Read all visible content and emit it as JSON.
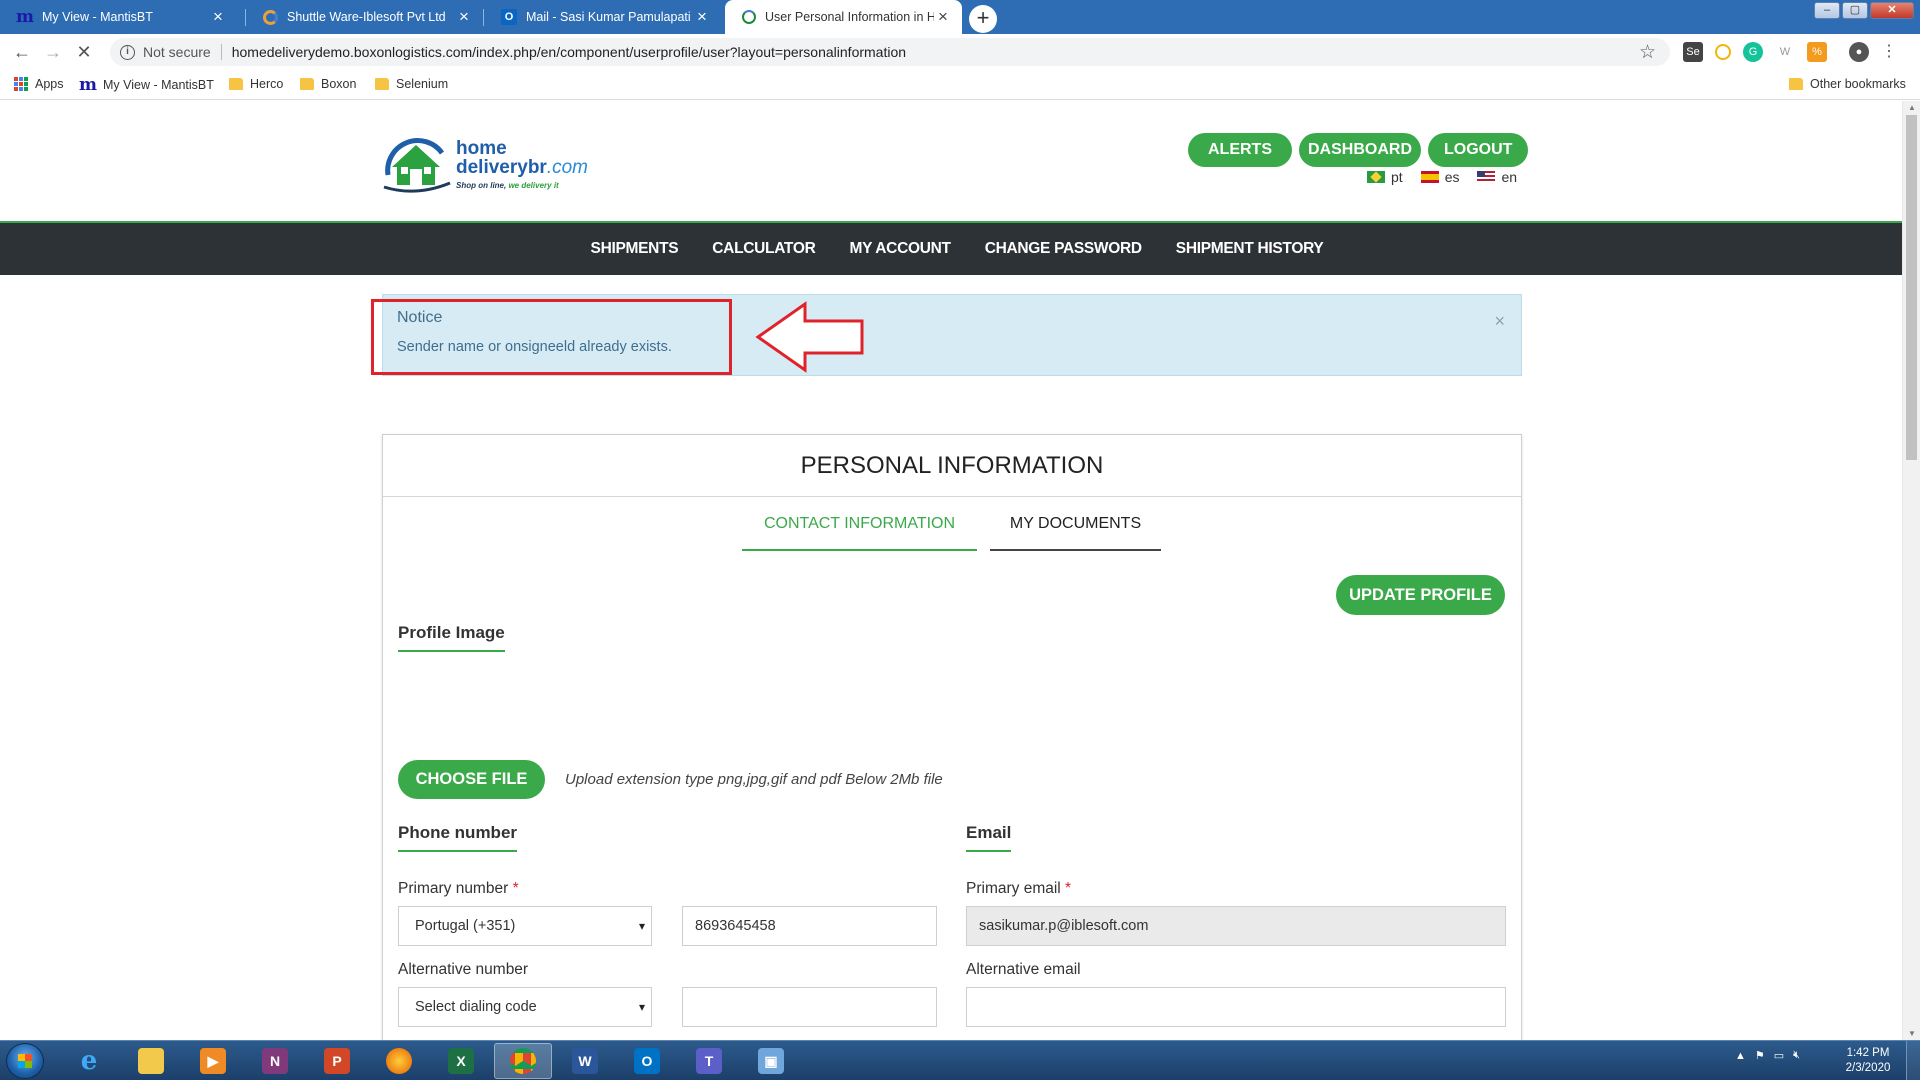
{
  "browser": {
    "tabs": [
      {
        "title": "My View - MantisBT",
        "favicon": "mantis-icon"
      },
      {
        "title": "Shuttle Ware-Iblesoft Pvt Ltd",
        "favicon": "shuttle-icon"
      },
      {
        "title": "Mail - Sasi Kumar Pamulapati - O",
        "favicon": "outlook-icon"
      },
      {
        "title": "User Personal Information in Her",
        "favicon": "globe-icon",
        "active": true
      }
    ],
    "new_tab": "+",
    "security_label": "Not secure",
    "url": "homedeliverydemo.boxonlogistics.com/index.php/en/component/userprofile/user?layout=personalinformation",
    "bookmarks": [
      {
        "label": "Apps",
        "icon": "apps-icon"
      },
      {
        "label": "My View - MantisBT",
        "icon": "mantis-icon"
      },
      {
        "label": "Herco",
        "icon": "folder-icon"
      },
      {
        "label": "Boxon",
        "icon": "folder-icon"
      },
      {
        "label": "Selenium",
        "icon": "folder-icon"
      }
    ],
    "other_bookmarks": "Other bookmarks"
  },
  "site": {
    "logo": {
      "line1": "home",
      "line2": "deliverybr",
      "tld": ".com",
      "tagline_a": "Shop on line,",
      "tagline_b": "we delivery it"
    },
    "top_buttons": {
      "alerts": "ALERTS",
      "dashboard": "DASHBOARD",
      "logout": "LOGOUT"
    },
    "languages": [
      {
        "code": "pt",
        "flag": "brazil-flag"
      },
      {
        "code": "es",
        "flag": "spain-flag"
      },
      {
        "code": "en",
        "flag": "usa-flag"
      }
    ],
    "nav": [
      "SHIPMENTS",
      "CALCULATOR",
      "MY ACCOUNT",
      "CHANGE PASSWORD",
      "SHIPMENT HISTORY"
    ],
    "brand_color": "#3aa94a",
    "nav_bg": "#2d3236"
  },
  "notice": {
    "title": "Notice",
    "message": "Sender name or onsigneeld already exists.",
    "close": "×",
    "annotation_color": "#e0232a"
  },
  "profile": {
    "title": "PERSONAL INFORMATION",
    "tabs": {
      "contact": "CONTACT INFORMATION",
      "documents": "MY DOCUMENTS"
    },
    "update_button": "UPDATE PROFILE",
    "profile_image_heading": "Profile Image",
    "choose_file": "CHOOSE FILE",
    "upload_hint": "Upload extension type png,jpg,gif and pdf Below 2Mb file",
    "phone_heading": "Phone number",
    "email_heading": "Email",
    "primary_number_label": "Primary number",
    "primary_country": "Portugal (+351)",
    "primary_number": "8693645458",
    "alternative_number_label": "Alternative number",
    "alternative_country_placeholder": "Select dialing code",
    "alternative_number": "",
    "primary_email_label": "Primary email",
    "primary_email": "sasikumar.p@iblesoft.com",
    "alternative_email_label": "Alternative email",
    "alternative_email": "",
    "required_mark": "*"
  },
  "taskbar": {
    "apps": [
      "internet-explorer-icon",
      "file-explorer-icon",
      "media-player-icon",
      "onenote-icon",
      "powerpoint-icon",
      "firefox-icon",
      "excel-icon",
      "chrome-icon",
      "word-icon",
      "outlook-icon",
      "teams-icon",
      "remote-desktop-icon"
    ],
    "time": "1:42 PM",
    "date": "2/3/2020"
  }
}
